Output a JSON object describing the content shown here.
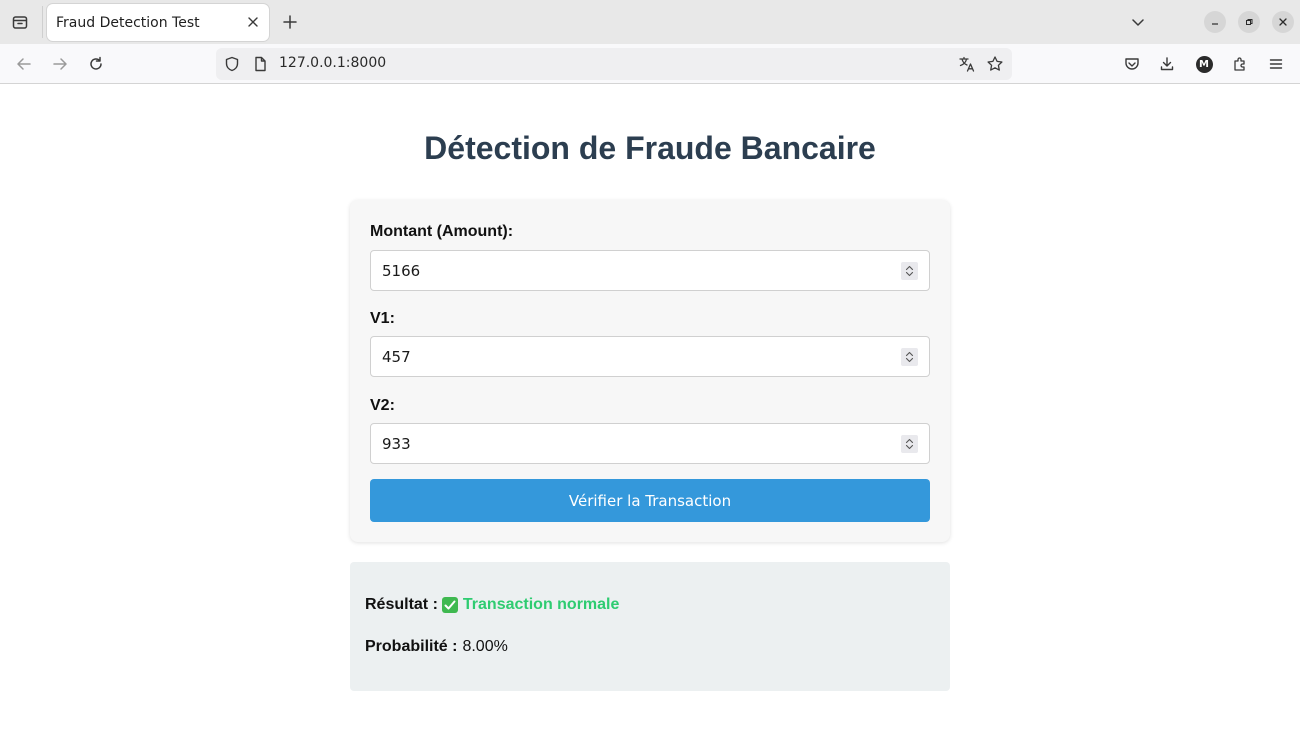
{
  "browser": {
    "tab_title": "Fraud Detection Test",
    "url": "127.0.0.1:8000"
  },
  "page": {
    "title": "Détection de Fraude Bancaire",
    "form": {
      "fields": [
        {
          "label": "Montant (Amount):",
          "value": "5166"
        },
        {
          "label": "V1:",
          "value": "457"
        },
        {
          "label": "V2:",
          "value": "933"
        }
      ],
      "submit_label": "Vérifier la Transaction"
    },
    "result": {
      "result_label": "Résultat :",
      "result_value": "Transaction normale",
      "probability_label": "Probabilité :",
      "probability_value": "8.00%"
    }
  },
  "colors": {
    "title": "#2c3e50",
    "button": "#3498db",
    "status_ok": "#2ecc71",
    "result_bg": "#ecf0f1"
  }
}
